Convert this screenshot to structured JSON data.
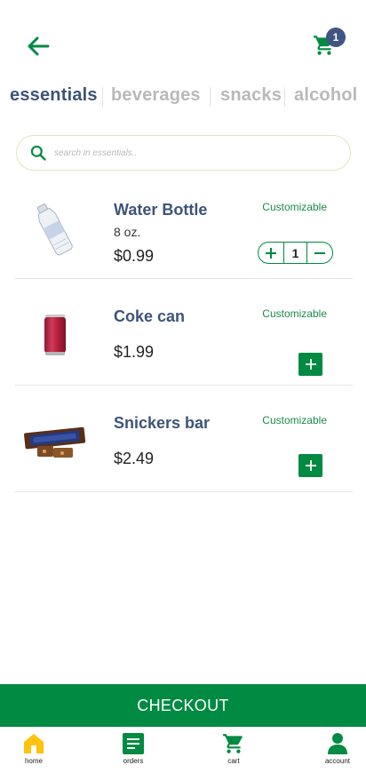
{
  "header": {
    "back_icon": "arrow-left-icon",
    "cart_icon": "cart-icon",
    "cart_count": "1",
    "accent": "#008a42",
    "badge_color": "#3f5684"
  },
  "categories": [
    {
      "label": "essentials",
      "active": true
    },
    {
      "label": "beverages",
      "active": false
    },
    {
      "label": "snacks",
      "active": false
    },
    {
      "label": "alcohol",
      "active": false
    }
  ],
  "search": {
    "placeholder": "search in essentials..",
    "value": ""
  },
  "items": [
    {
      "name": "Water Bottle",
      "size": "8 oz.",
      "price": "$0.99",
      "customize_label": "Customizable",
      "quantity": "1",
      "in_cart": true,
      "image": "water-bottle"
    },
    {
      "name": "Coke can",
      "size": "",
      "price": "$1.99",
      "customize_label": "Customizable",
      "quantity": "0",
      "in_cart": false,
      "image": "coke-can"
    },
    {
      "name": "Snickers bar",
      "size": "",
      "price": "$2.49",
      "customize_label": "Customizable",
      "quantity": "0",
      "in_cart": false,
      "image": "snickers-bar"
    }
  ],
  "checkout": {
    "label": "CHECKOUT"
  },
  "bottom_nav": [
    {
      "label": "home",
      "icon": "home-icon",
      "color": "#ffc20e"
    },
    {
      "label": "orders",
      "icon": "orders-icon",
      "color": "#008a42"
    },
    {
      "label": "cart",
      "icon": "cart-icon",
      "color": "#008a42"
    },
    {
      "label": "account",
      "icon": "account-icon",
      "color": "#008a42"
    }
  ]
}
